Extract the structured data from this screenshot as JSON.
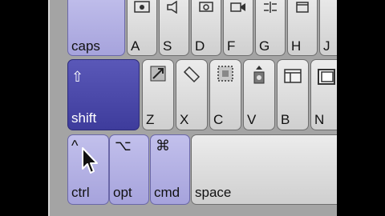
{
  "row_top": [
    {
      "label": "caps",
      "modifier": true
    },
    {
      "label": "A",
      "icon": "music-video-icon"
    },
    {
      "label": "S",
      "icon": "speaker-icon"
    },
    {
      "label": "D",
      "icon": "camera-icon"
    },
    {
      "label": "F",
      "icon": "video-camera-icon"
    },
    {
      "label": "G",
      "icon": "grid-icon"
    },
    {
      "label": "H",
      "icon": "window-icon"
    },
    {
      "label": "J"
    }
  ],
  "row_middle": [
    {
      "label": "shift",
      "symbol": "⇧",
      "modifier": true
    },
    {
      "label": "Z",
      "icon": "resize-icon"
    },
    {
      "label": "X",
      "icon": "eraser-icon"
    },
    {
      "label": "C",
      "icon": "crop-icon"
    },
    {
      "label": "V",
      "icon": "stamp-icon"
    },
    {
      "label": "B",
      "icon": "window-panel-icon"
    },
    {
      "label": "N",
      "icon": "square-frame-icon"
    }
  ],
  "row_bottom": [
    {
      "label": "ctrl",
      "symbol": "^",
      "modifier": true
    },
    {
      "label": "opt",
      "symbol": "⌥",
      "modifier": true
    },
    {
      "label": "cmd",
      "symbol": "⌘",
      "modifier": true
    },
    {
      "label": "space"
    }
  ],
  "colors": {
    "shift_active": "#4a48aa",
    "modifier": "#b4b2e4",
    "key": "#dcdcdc",
    "panel": "#a4a4a4"
  }
}
